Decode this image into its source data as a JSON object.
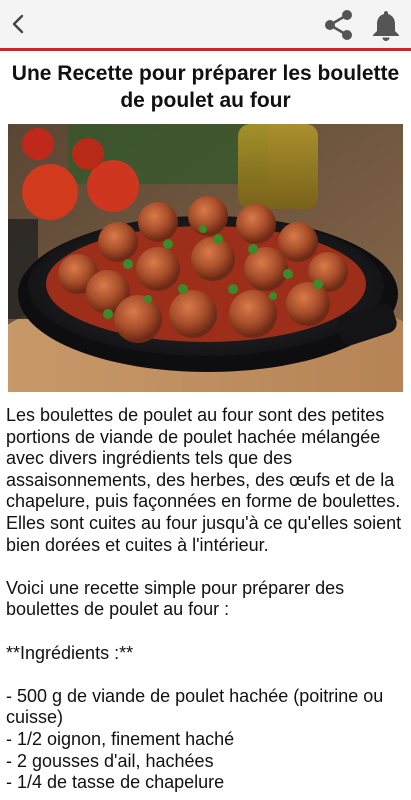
{
  "header": {
    "back_icon": "chevron-left-icon",
    "share_icon": "share-icon",
    "notification_icon": "bell-icon",
    "accent_color": "#d6202a"
  },
  "article": {
    "title": "Une Recette pour préparer les boulette de poulet au four",
    "image": "chicken-meatballs-in-tomato-sauce-photo",
    "intro": "Les boulettes de poulet au four sont des petites portions de viande de poulet hachée mélangée avec divers ingrédients tels que des assaisonnements, des herbes, des œufs et de la chapelure, puis façonnées en forme de boulettes. Elles sont cuites au four jusqu'à ce qu'elles soient bien dorées et cuites à l'intérieur.",
    "lead": "Voici une recette simple pour préparer des boulettes de poulet au four :",
    "ingredients_heading": "**Ingrédients :**",
    "ingredients": [
      "- 500 g de viande de poulet hachée (poitrine ou cuisse)",
      "- 1/2 oignon, finement haché",
      "- 2 gousses d'ail, hachées",
      "- 1/4 de tasse de chapelure"
    ]
  }
}
